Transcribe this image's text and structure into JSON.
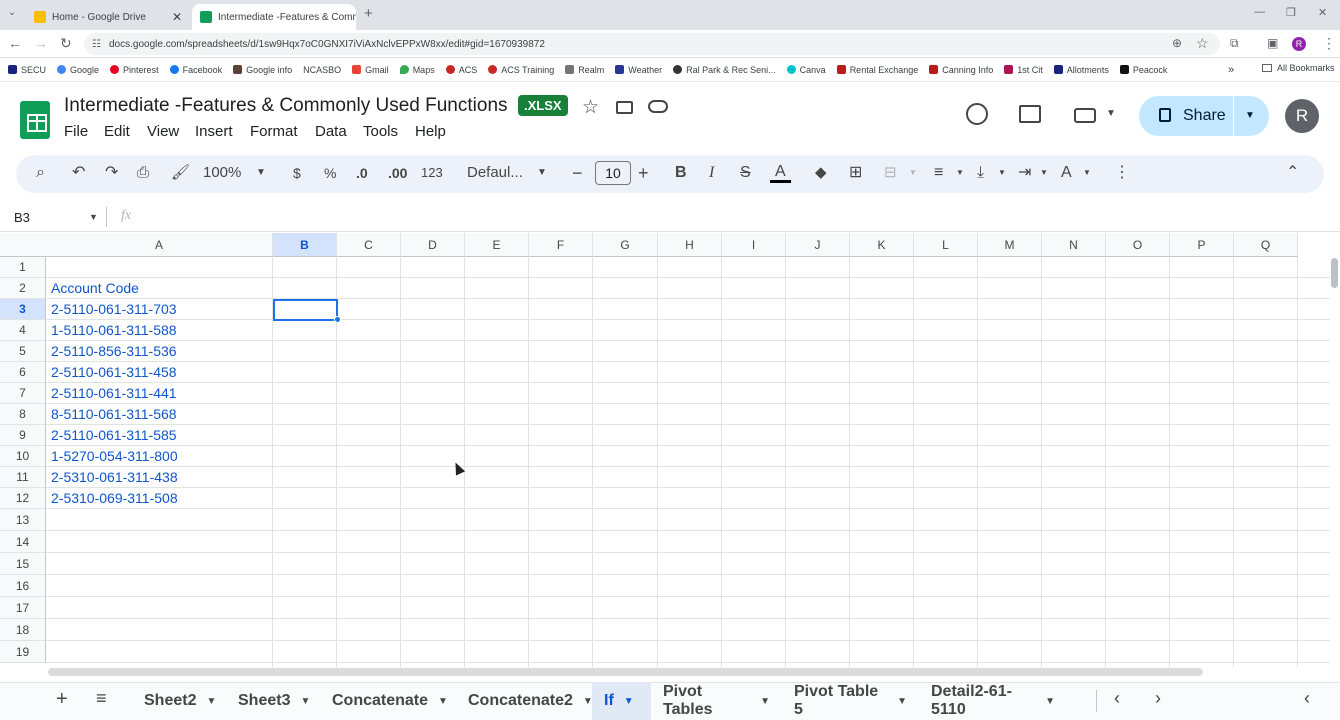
{
  "browser": {
    "tabs": [
      {
        "title": "Home - Google Drive",
        "active": false,
        "color": "#fbbc04"
      },
      {
        "title": "Intermediate -Features & Comm",
        "active": true,
        "color": "#0f9d58"
      }
    ],
    "url": "docs.google.com/spreadsheets/d/1sw9Hqx7oC0GNXI7iViAxNclvEPPxW8xx/edit#gid=1670939872",
    "bookmarks": [
      "SECU",
      "Google",
      "Pinterest",
      "Facebook",
      "Google info",
      "NCASBO",
      "Gmail",
      "Maps",
      "ACS",
      "ACS Training",
      "Realm",
      "Weather",
      "Ral Park & Rec Seni...",
      "Canva",
      "Rental Exchange",
      "Canning Info",
      "1st Cit",
      "Allotments",
      "Peacock"
    ],
    "all_bookmarks": "All Bookmarks"
  },
  "doc": {
    "title": "Intermediate -Features & Commonly Used Functions",
    "badge": ".XLSX",
    "menus": [
      "File",
      "Edit",
      "View",
      "Insert",
      "Format",
      "Data",
      "Tools",
      "Help"
    ],
    "share": "Share",
    "avatar": "R"
  },
  "toolbar": {
    "zoom": "100%",
    "currency": "$",
    "percent": "%",
    "dec_less": ".0",
    "dec_more": ".00",
    "number_format": "123",
    "font": "Defaul...",
    "font_size": "10",
    "bold": "B",
    "italic": "I",
    "strike": "S"
  },
  "formula_bar": {
    "name_box": "B3",
    "fx": "fx",
    "value": ""
  },
  "grid": {
    "columns": [
      "A",
      "B",
      "C",
      "D",
      "E",
      "F",
      "G",
      "H",
      "I",
      "J",
      "K",
      "L",
      "M",
      "N",
      "O",
      "P",
      "Q"
    ],
    "rows": [
      "1",
      "2",
      "3",
      "4",
      "5",
      "6",
      "7",
      "8",
      "9",
      "10",
      "11",
      "12",
      "13",
      "14",
      "15",
      "16",
      "17",
      "18",
      "19"
    ],
    "selected_cell": "B3",
    "cells_A": [
      "",
      "Account Code",
      "2-5110-061-311-703",
      "1-5110-061-311-588",
      "2-5110-856-311-536",
      "2-5110-061-311-458",
      "2-5110-061-311-441",
      "8-5110-061-311-568",
      "2-5110-061-311-585",
      "1-5270-054-311-800",
      "2-5310-061-311-438",
      "2-5310-069-311-508"
    ]
  },
  "sheets": [
    {
      "name": "Sheet2",
      "active": false
    },
    {
      "name": "Sheet3",
      "active": false
    },
    {
      "name": "Concatenate",
      "active": false
    },
    {
      "name": "Concatenate2",
      "active": false
    },
    {
      "name": "If",
      "active": true
    },
    {
      "name": "Pivot Tables",
      "active": false
    },
    {
      "name": "Pivot Table 5",
      "active": false
    },
    {
      "name": "Detail2-61-5110",
      "active": false
    }
  ]
}
